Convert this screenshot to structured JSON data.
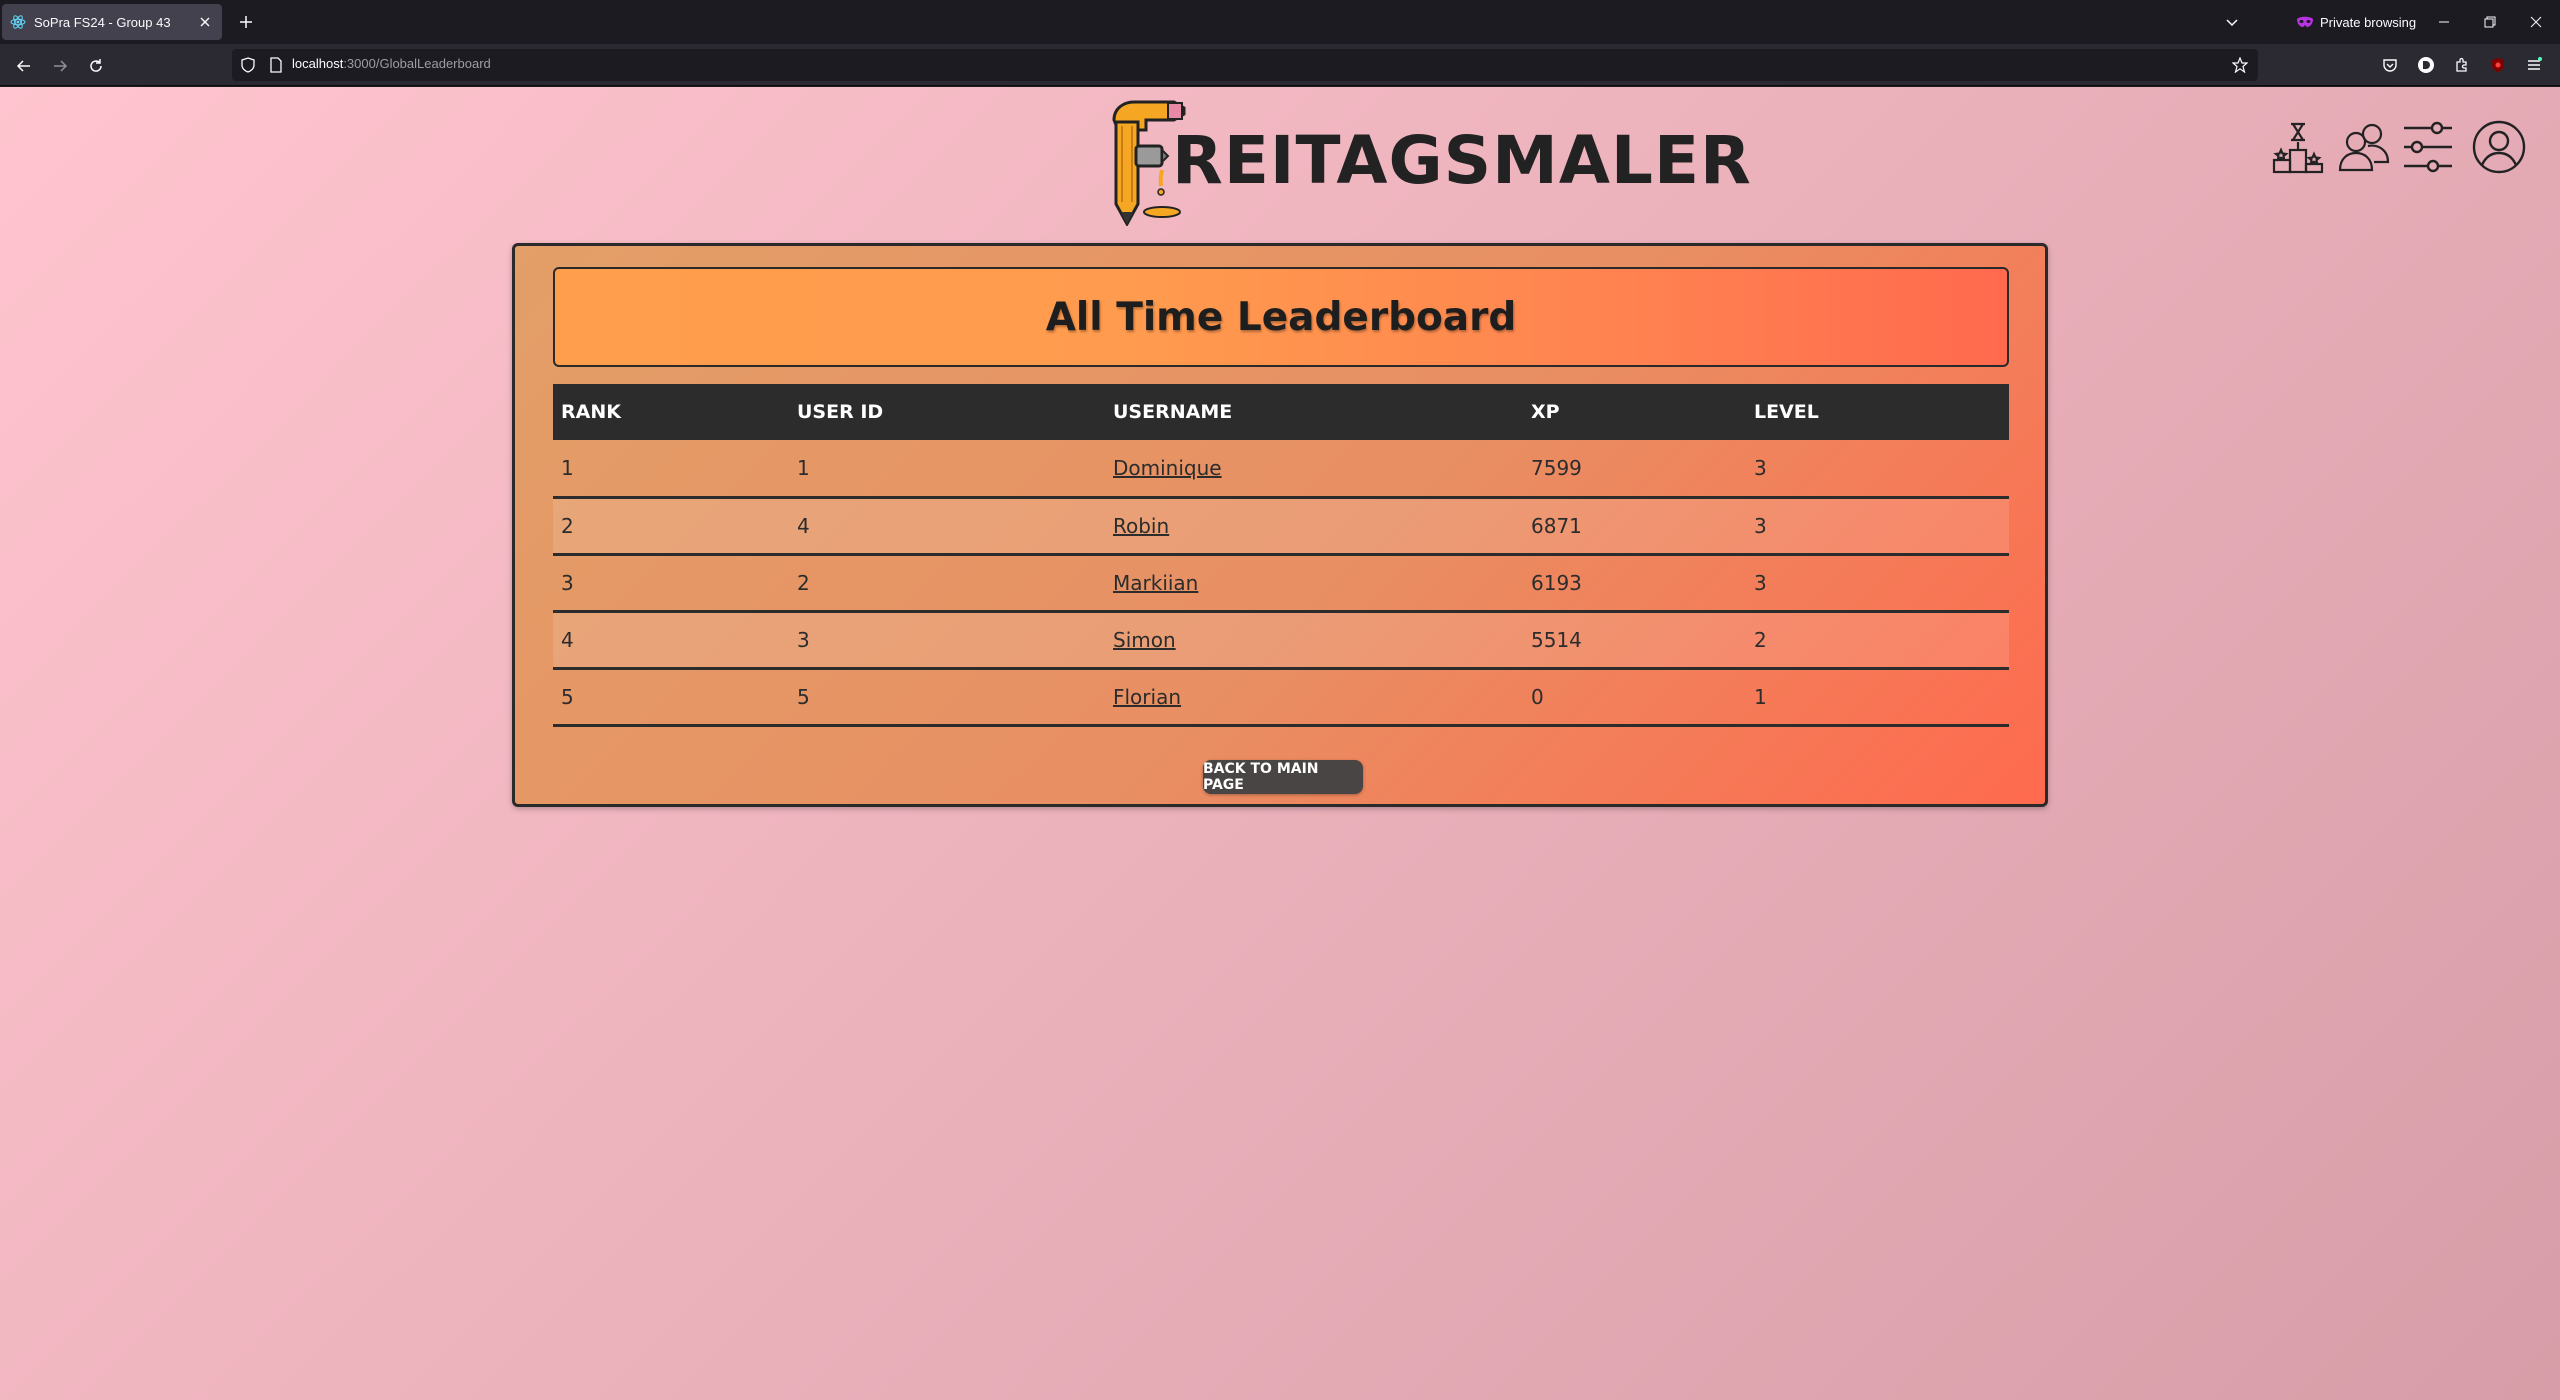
{
  "browser": {
    "tab_title": "SoPra FS24 - Group 43",
    "private_label": "Private browsing",
    "url_host": "localhost",
    "url_path": ":3000/GlobalLeaderboard"
  },
  "header": {
    "logo_text": "REITAGSMALER",
    "icons": [
      "leaderboard-podium-icon",
      "friends-icon",
      "settings-sliders-icon",
      "profile-icon"
    ]
  },
  "leaderboard": {
    "title": "All Time Leaderboard",
    "columns": [
      "RANK",
      "USER ID",
      "USERNAME",
      "XP",
      "LEVEL"
    ],
    "rows": [
      {
        "rank": "1",
        "user_id": "1",
        "username": "Dominique",
        "xp": "7599",
        "level": "3"
      },
      {
        "rank": "2",
        "user_id": "4",
        "username": "Robin",
        "xp": "6871",
        "level": "3"
      },
      {
        "rank": "3",
        "user_id": "2",
        "username": "Markiian",
        "xp": "6193",
        "level": "3"
      },
      {
        "rank": "4",
        "user_id": "3",
        "username": "Simon",
        "xp": "5514",
        "level": "2"
      },
      {
        "rank": "5",
        "user_id": "5",
        "username": "Florian",
        "xp": "0",
        "level": "1"
      }
    ],
    "back_button": "BACK TO MAIN PAGE"
  }
}
